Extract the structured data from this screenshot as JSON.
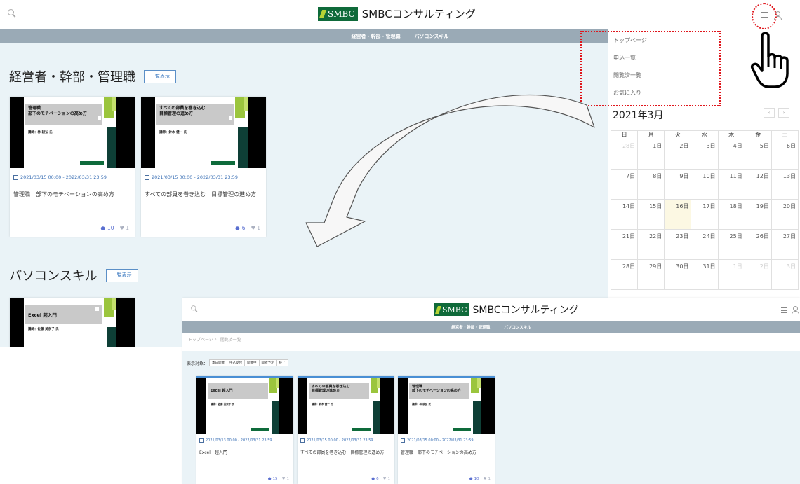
{
  "header": {
    "logo_badge": "SMBC",
    "logo_text": "SMBCコンサルティング"
  },
  "nav": {
    "items": [
      "経営者・幹部・管理職",
      "パソコンスキル"
    ]
  },
  "dropdown_menu": {
    "items": [
      "トップページ",
      "申込一覧",
      "閲覧済一覧",
      "お気に入り"
    ]
  },
  "section1": {
    "title": "経営者・幹部・管理職",
    "list_button": "一覧表示",
    "cards": [
      {
        "thumb_title": "管理職\n部下のモチベーションの高め方",
        "thumb_instructor": "講師：林 耕弘 氏",
        "date": "2021/03/15 00:00 -   2022/03/31 23:59",
        "title": "管理職　部下のモチベーションの高め方",
        "views": "10",
        "likes": "1"
      },
      {
        "thumb_title": "すべての部員を巻き込む\n目標管理の進め方",
        "thumb_instructor": "講師：鈴木 健一 氏",
        "date": "2021/03/15 00:00 -   2022/03/31 23:59",
        "title": "すべての部員を巻き込む　目標管理の進め方",
        "views": "6",
        "likes": "1"
      }
    ]
  },
  "section2": {
    "title": "パソコンスキル",
    "list_button": "一覧表示",
    "cards": [
      {
        "thumb_title": "Excel  超入門",
        "thumb_instructor": "講師：佐藤 美奈子 氏"
      }
    ]
  },
  "calendar": {
    "title": "2021年3月",
    "prev": "‹",
    "next": "›",
    "weekdays": [
      "日",
      "月",
      "火",
      "水",
      "木",
      "金",
      "土"
    ],
    "weeks": [
      [
        "28日",
        "1日",
        "2日",
        "3日",
        "4日",
        "5日",
        "6日"
      ],
      [
        "7日",
        "8日",
        "9日",
        "10日",
        "11日",
        "12日",
        "13日"
      ],
      [
        "14日",
        "15日",
        "16日",
        "17日",
        "18日",
        "19日",
        "20日"
      ],
      [
        "21日",
        "22日",
        "23日",
        "24日",
        "25日",
        "26日",
        "27日"
      ],
      [
        "28日",
        "29日",
        "30日",
        "31日",
        "1日",
        "2日",
        "3日"
      ]
    ],
    "muted_cells": [
      "0-0",
      "4-4",
      "4-5",
      "4-6"
    ],
    "today_cell": "2-2"
  },
  "screen2": {
    "logo_badge": "SMBC",
    "logo_text": "SMBCコンサルティング",
    "nav_items": [
      "経営者・幹部・管理職",
      "パソコンスキル"
    ],
    "breadcrumb": "トップページ 〉 閲覧済一覧",
    "filter_label": "表示対象：",
    "filter_options": [
      "本日開催",
      "申込受付",
      "開催中",
      "開催予定",
      "終了"
    ],
    "cards": [
      {
        "thumb_title": "Excel  超入門",
        "thumb_instructor": "講師：佐藤 美奈子 氏",
        "date": "2021/03/13 00:00 -   2022/03/31 23:59",
        "title": "Excel　超入門",
        "views": "15",
        "likes": "1"
      },
      {
        "thumb_title": "すべての部員を巻き込む\n目標管理の進め方",
        "thumb_instructor": "講師：鈴木 健一 氏",
        "date": "2021/03/15 00:00 -   2022/03/31 23:59",
        "title": "すべての部員を巻き込む　目標管理の進め方",
        "views": "6",
        "likes": "1"
      },
      {
        "thumb_title": "管理職\n部下のモチベーションの高め方",
        "thumb_instructor": "講師：林 耕弘 氏",
        "date": "2021/03/15 00:00 -   2022/03/31 23:59",
        "title": "管理職　部下のモチベーションの高め方",
        "views": "10",
        "likes": "1"
      }
    ]
  },
  "colors": {
    "brand_green": "#0f6a3a",
    "nav_gray": "#9aaab6",
    "content_bg": "#eaf3f7",
    "highlight_red": "#e0161c",
    "link_blue": "#3b70b5"
  }
}
